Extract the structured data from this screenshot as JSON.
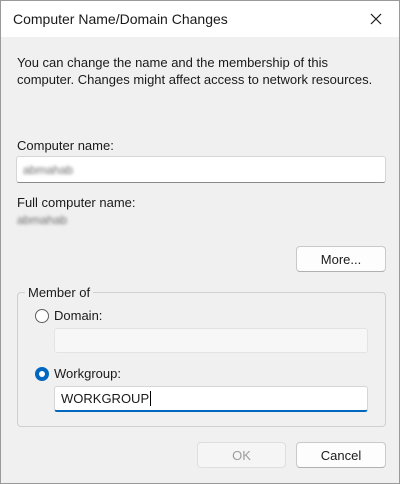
{
  "window": {
    "title": "Computer Name/Domain Changes"
  },
  "description": "You can change the name and the membership of this computer. Changes might affect access to network resources.",
  "computer_name": {
    "label": "Computer name:",
    "value": "abmahab"
  },
  "full_computer_name": {
    "label": "Full computer name:",
    "value": "abmahab"
  },
  "more_button": "More...",
  "member_of": {
    "legend": "Member of",
    "domain": {
      "label": "Domain:",
      "selected": false,
      "value": ""
    },
    "workgroup": {
      "label": "Workgroup:",
      "selected": true,
      "value": "WORKGROUP"
    }
  },
  "buttons": {
    "ok": "OK",
    "cancel": "Cancel"
  },
  "colors": {
    "accent": "#0067c0",
    "dialog_bg": "#f0f0f0",
    "disabled_text": "#9d9d9d"
  },
  "icons": {
    "close": "close-icon"
  }
}
